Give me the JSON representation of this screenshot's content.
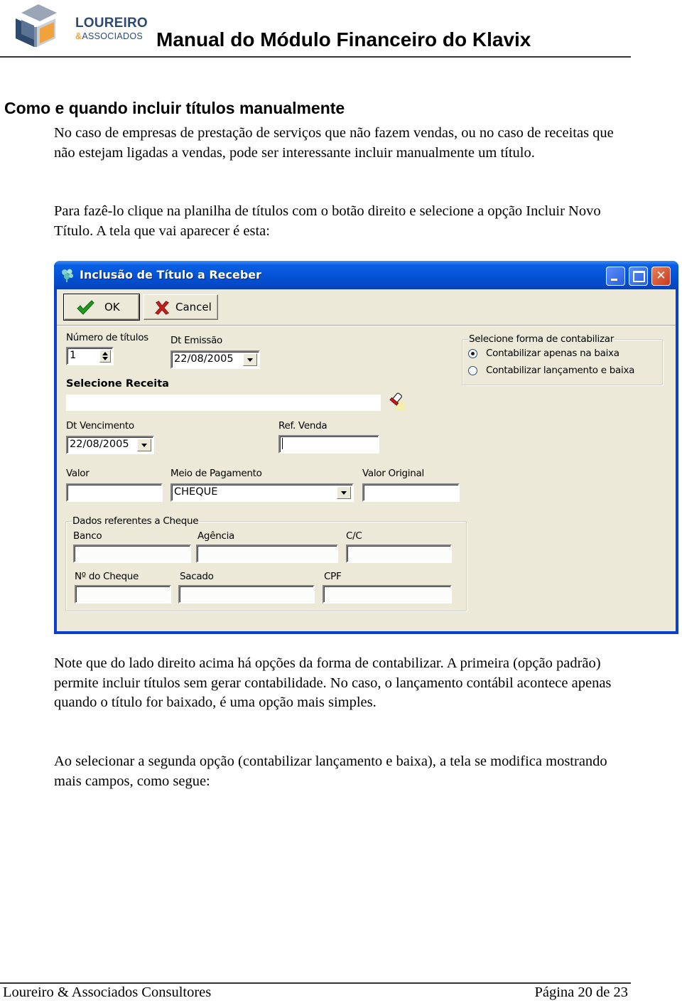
{
  "header": {
    "logo_line1": "LOUREIRO",
    "logo_amp": "&",
    "logo_line2": "ASSOCIADOS",
    "doc_title": "Manual do Módulo Financeiro do Klavix"
  },
  "section": {
    "title": "Como e quando incluir títulos manualmente",
    "paragraphs": [
      "No caso de empresas de prestação de serviços que não fazem vendas, ou no caso de receitas que não estejam ligadas a vendas, pode ser interessante incluir manualmente um título.",
      "Para fazê-lo clique na planilha de títulos com o botão direito e selecione a opção Incluir Novo Título.  A tela que vai aparecer é esta:",
      "Note que do lado direito acima há opções da forma de contabilizar.  A primeira (opção padrão) permite incluir títulos sem gerar contabilidade.  No caso, o lançamento contábil acontece apenas quando o título for baixado, é uma opção mais simples.",
      "Ao selecionar a segunda opção (contabilizar lançamento e baixa), a tela se modifica mostrando mais campos, como segue:"
    ]
  },
  "dialog": {
    "title": "Inclusão de Título a Receber",
    "caption_buttons": {
      "minimize": "_",
      "maximize": "□",
      "close": "✕"
    },
    "toolbar": {
      "ok_label": "OK",
      "cancel_label": "Cancel"
    },
    "fields": {
      "numero_titulos": {
        "label": "Número de títulos",
        "value": "1"
      },
      "dt_emissao": {
        "label": "Dt Emissão",
        "value": "22/08/2005"
      },
      "selecione_receita": {
        "label": "Selecione Receita",
        "value": ""
      },
      "dt_vencimento": {
        "label": "Dt Vencimento",
        "value": "22/08/2005"
      },
      "ref_venda": {
        "label": "Ref. Venda",
        "value": ""
      },
      "valor": {
        "label": "Valor",
        "value": ""
      },
      "meio_pagamento": {
        "label": "Meio de Pagamento",
        "value": "CHEQUE"
      },
      "valor_original": {
        "label": "Valor Original",
        "value": ""
      }
    },
    "contabilizar_group": {
      "legend": "Selecione forma de contabilizar",
      "options": [
        {
          "label": "Contabilizar apenas na baixa",
          "selected": true
        },
        {
          "label": "Contabilizar lançamento e baixa",
          "selected": false
        }
      ]
    },
    "cheque_group": {
      "legend": "Dados referentes a Cheque",
      "fields": {
        "banco": {
          "label": "Banco",
          "value": ""
        },
        "agencia": {
          "label": "Agência",
          "value": ""
        },
        "cc": {
          "label": "C/C",
          "value": ""
        },
        "num_cheque": {
          "label": "Nº do Cheque",
          "value": ""
        },
        "sacado": {
          "label": "Sacado",
          "value": ""
        },
        "cpf": {
          "label": "CPF",
          "value": ""
        }
      }
    }
  },
  "footer": {
    "left": "Loureiro & Associados Consultores",
    "right": "Página 20 de 23"
  },
  "colors": {
    "titlebar": "#0553d6",
    "window_face": "#ece9d8",
    "logo_blue": "#2e4a6e",
    "logo_orange": "#f2a23c"
  }
}
